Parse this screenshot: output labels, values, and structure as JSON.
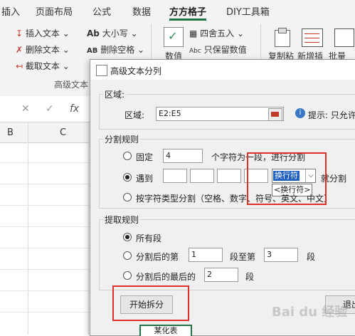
{
  "ribbon": {
    "tabs": [
      "插入",
      "页面布局",
      "公式",
      "数据",
      "方方格子",
      "DIY工具箱"
    ],
    "active_tab": "方方格子",
    "text_group": {
      "items": [
        "插入文本",
        "删除文本",
        "截取文本",
        "大小写",
        "删除空格"
      ],
      "label": "高级文本"
    },
    "numbers": {
      "round": "四舍五入",
      "keep_numbers": "只保留数值",
      "value_label": "数值"
    },
    "copy_paste": "复制粘",
    "new_insert": "新增插",
    "batch": "批量"
  },
  "formula_bar": {
    "fx": "fx"
  },
  "columns": [
    "B",
    "C"
  ],
  "dialog": {
    "title": "高级文本分列",
    "region": {
      "legend": "区域:",
      "label": "区域:",
      "value": "E2:E5",
      "hint": "提示: 只允许"
    },
    "split": {
      "legend": "分割规则",
      "fixed_label": "固定",
      "fixed_value": "4",
      "fixed_suffix": "个字符为一段，进行分割",
      "encounter_label": "遇到",
      "delimiter_selected": "换行符",
      "delimiter_option": "<换行符>",
      "encounter_suffix": "就分割",
      "by_type_label": "按字符类型分割（空格、数字、符号、英文、中文）"
    },
    "extract": {
      "legend": "提取规则",
      "all": "所有段",
      "after_label": "分割后的第",
      "after_from": "1",
      "to_label": "段至第",
      "after_to": "3",
      "seg_label": "段",
      "last_label": "分割后的最后的",
      "last_value": "2",
      "last_seg": "段"
    },
    "start_button": "开始拆分",
    "exit_button": "退出"
  },
  "sheet_cell_text": "某化表",
  "watermark": "Bai du 经验"
}
